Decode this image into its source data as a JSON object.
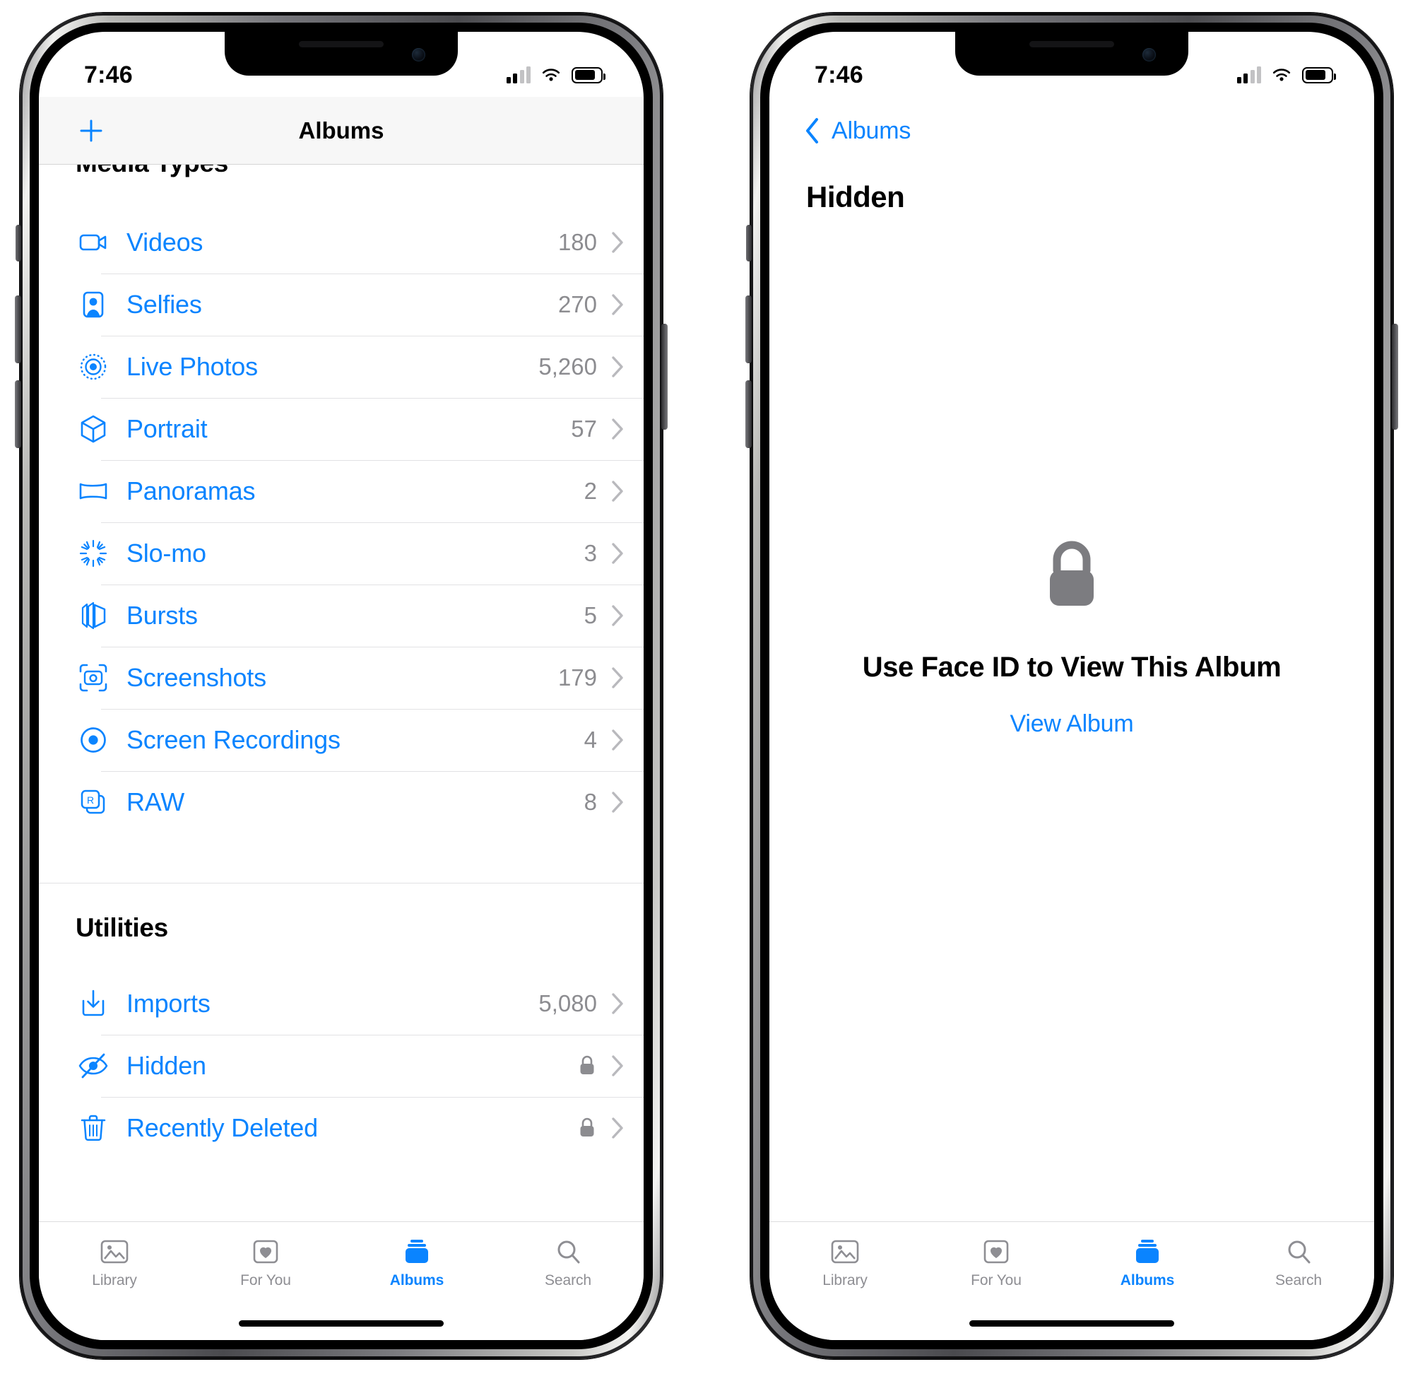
{
  "status_bar": {
    "time": "7:46",
    "signal_icon": "cellular-signal-icon",
    "wifi_icon": "wifi-icon",
    "battery_icon": "battery-icon"
  },
  "left_phone": {
    "nav": {
      "add_icon": "plus-icon",
      "title": "Albums"
    },
    "sections": [
      {
        "header": "Media Types",
        "clipped": true,
        "rows": [
          {
            "icon": "video-camera-icon",
            "label": "Videos",
            "count": "180",
            "locked": false
          },
          {
            "icon": "person-portrait-icon",
            "label": "Selfies",
            "count": "270",
            "locked": false
          },
          {
            "icon": "live-photo-icon",
            "label": "Live Photos",
            "count": "5,260",
            "locked": false
          },
          {
            "icon": "cube-icon",
            "label": "Portrait",
            "count": "57",
            "locked": false
          },
          {
            "icon": "panorama-icon",
            "label": "Panoramas",
            "count": "2",
            "locked": false
          },
          {
            "icon": "slomo-icon",
            "label": "Slo-mo",
            "count": "3",
            "locked": false
          },
          {
            "icon": "bursts-icon",
            "label": "Bursts",
            "count": "5",
            "locked": false
          },
          {
            "icon": "screenshot-icon",
            "label": "Screenshots",
            "count": "179",
            "locked": false
          },
          {
            "icon": "record-circle-icon",
            "label": "Screen Recordings",
            "count": "4",
            "locked": false
          },
          {
            "icon": "raw-icon",
            "label": "RAW",
            "count": "8",
            "locked": false
          }
        ]
      },
      {
        "header": "Utilities",
        "clipped": false,
        "rows": [
          {
            "icon": "import-tray-icon",
            "label": "Imports",
            "count": "5,080",
            "locked": false
          },
          {
            "icon": "eye-slash-icon",
            "label": "Hidden",
            "count": "",
            "locked": true
          },
          {
            "icon": "trash-icon",
            "label": "Recently Deleted",
            "count": "",
            "locked": true
          }
        ]
      }
    ]
  },
  "right_phone": {
    "nav": {
      "back_icon": "chevron-left-icon",
      "back_label": "Albums"
    },
    "title": "Hidden",
    "locked": {
      "lock_icon": "lock-closed-icon",
      "message": "Use Face ID to View This Album",
      "action": "View Album"
    }
  },
  "tab_bar": {
    "tabs": [
      {
        "icon": "photos-library-icon",
        "label": "Library",
        "active": false
      },
      {
        "icon": "heart-card-icon",
        "label": "For You",
        "active": false
      },
      {
        "icon": "albums-stack-icon",
        "label": "Albums",
        "active": true
      },
      {
        "icon": "magnifier-icon",
        "label": "Search",
        "active": false
      }
    ]
  },
  "colors": {
    "accent": "#0a84ff",
    "inactive": "#8e8e93",
    "separator": "#e2e2e4",
    "count_text": "#8c8c90"
  }
}
